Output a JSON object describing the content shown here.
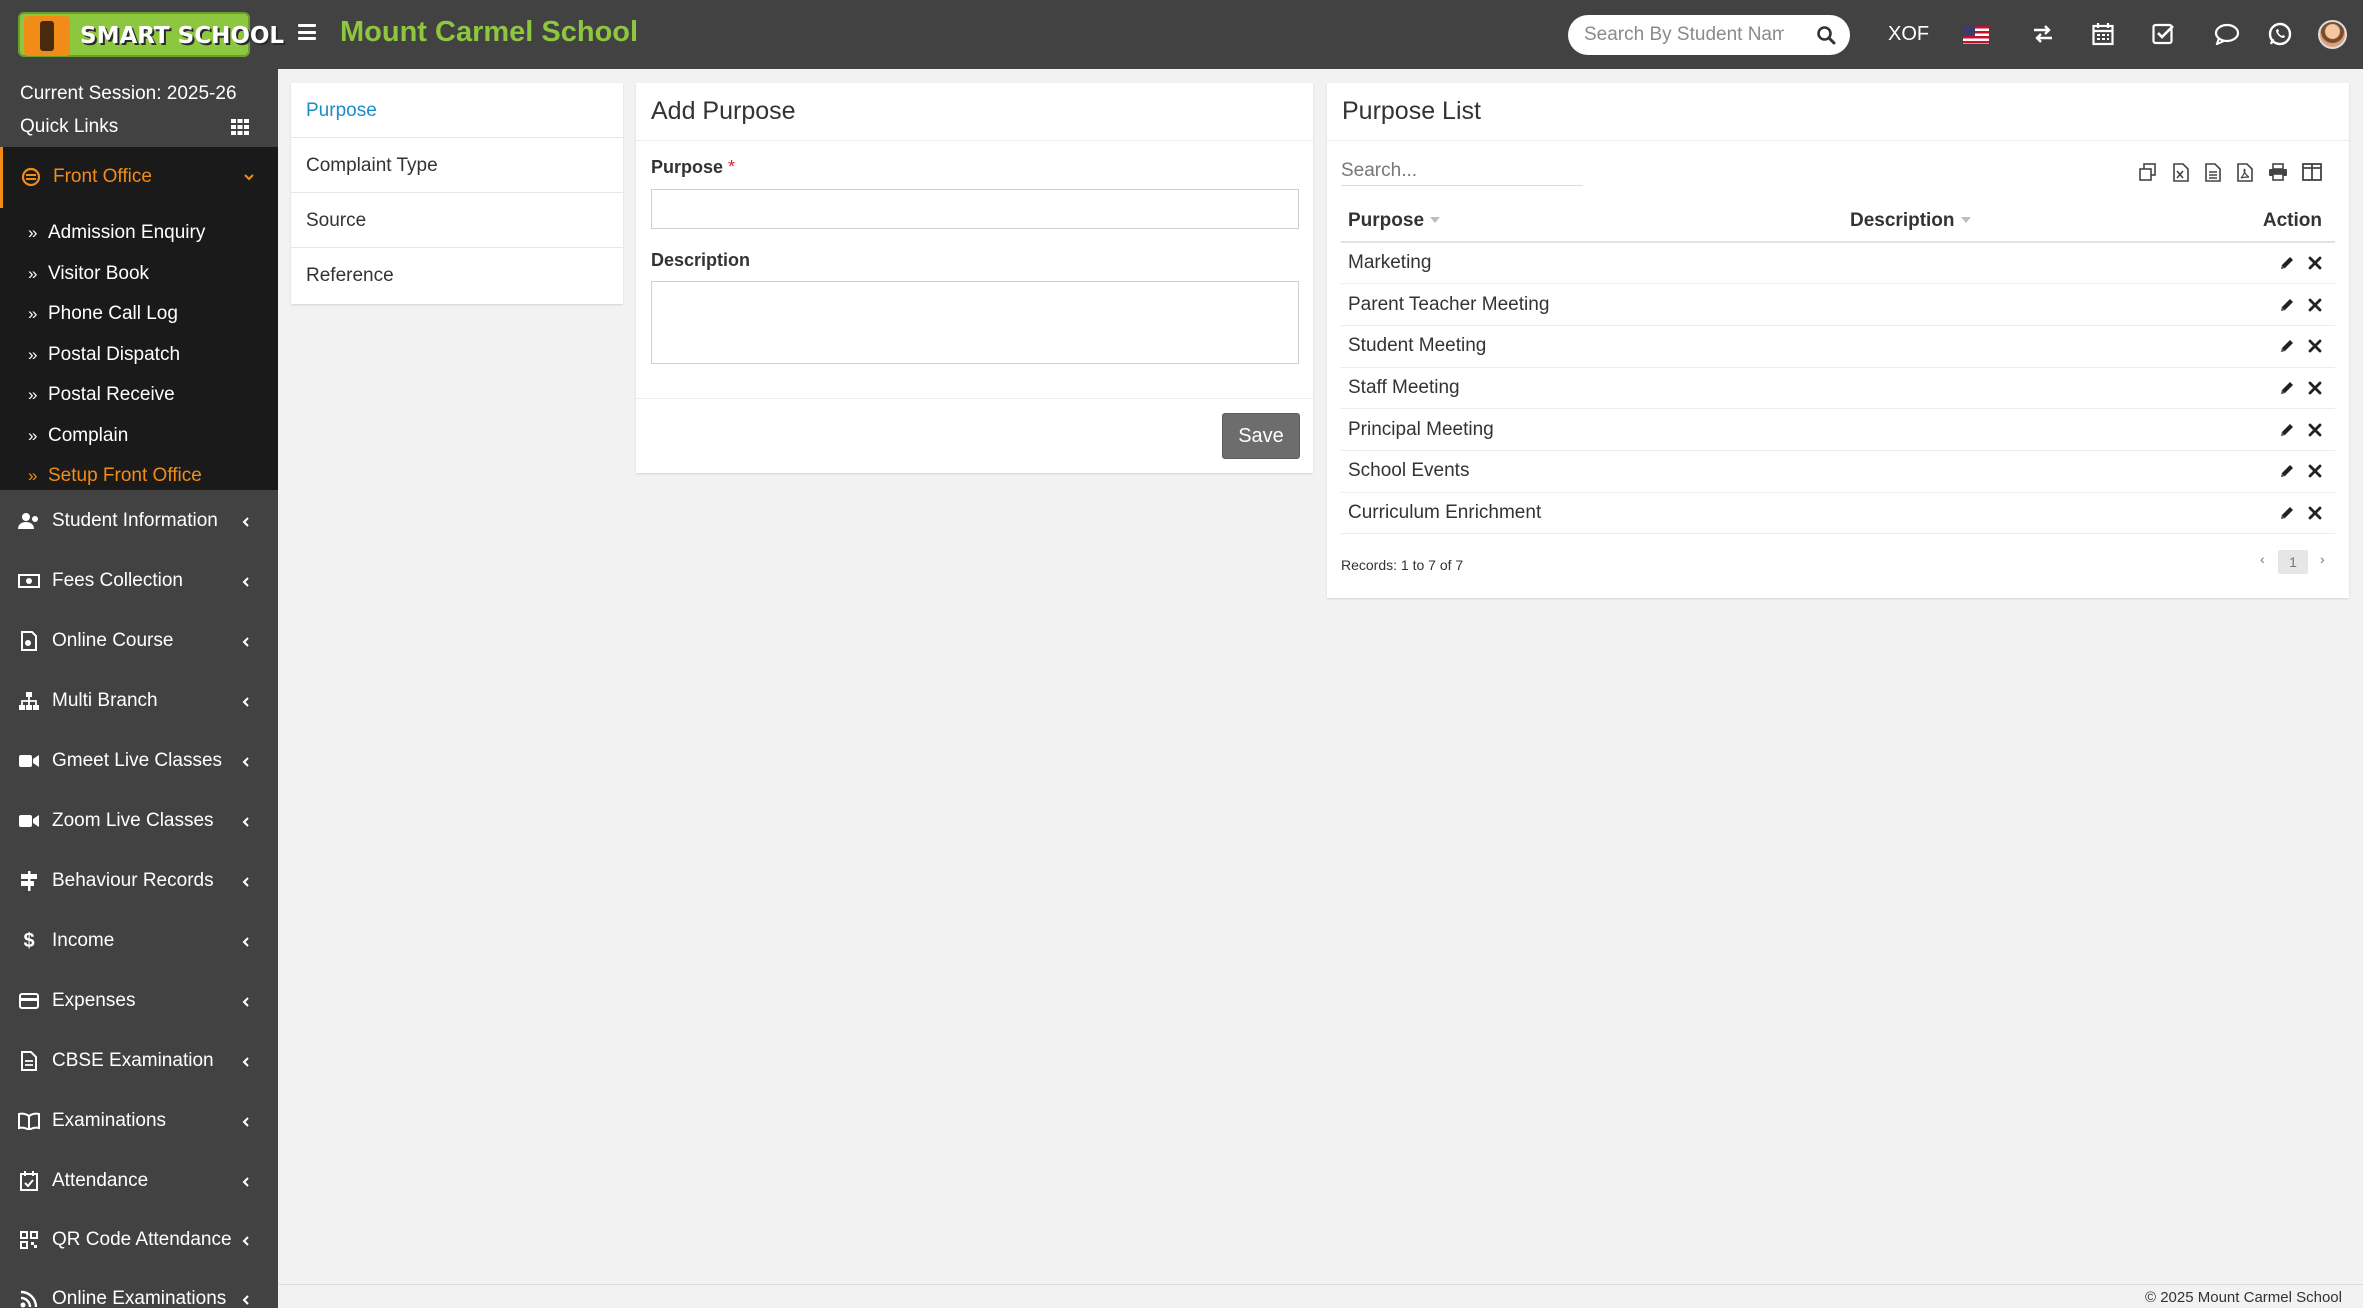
{
  "header": {
    "logo_text": "SMART SCHOOL",
    "school_name": "Mount Carmel School",
    "search_placeholder": "Search By Student Name",
    "currency": "XOF",
    "icons": [
      "menu-icon",
      "search-icon",
      "us-flag-icon",
      "exchange-icon",
      "calendar-icon",
      "task-check-icon",
      "chat-icon",
      "whatsapp-icon",
      "user-avatar"
    ]
  },
  "sidebar": {
    "session_label": "Current Session: 2025-26",
    "quick_links_label": "Quick Links",
    "active_section": {
      "label": "Front Office",
      "items": [
        {
          "label": "Admission Enquiry"
        },
        {
          "label": "Visitor Book"
        },
        {
          "label": "Phone Call Log"
        },
        {
          "label": "Postal Dispatch"
        },
        {
          "label": "Postal Receive"
        },
        {
          "label": "Complain"
        },
        {
          "label": "Setup Front Office",
          "active": true
        }
      ]
    },
    "items": [
      {
        "label": "Student Information",
        "icon": "user-group-icon"
      },
      {
        "label": "Fees Collection",
        "icon": "money-icon"
      },
      {
        "label": "Online Course",
        "icon": "course-icon"
      },
      {
        "label": "Multi Branch",
        "icon": "sitemap-icon"
      },
      {
        "label": "Gmeet Live Classes",
        "icon": "video-icon"
      },
      {
        "label": "Zoom Live Classes",
        "icon": "video-icon"
      },
      {
        "label": "Behaviour Records",
        "icon": "signpost-icon"
      },
      {
        "label": "Income",
        "icon": "dollar-icon"
      },
      {
        "label": "Expenses",
        "icon": "credit-card-icon"
      },
      {
        "label": "CBSE Examination",
        "icon": "document-icon"
      },
      {
        "label": "Examinations",
        "icon": "book-open-icon"
      },
      {
        "label": "Attendance",
        "icon": "calendar-check-icon"
      },
      {
        "label": "QR Code Attendance",
        "icon": "qrcode-icon"
      },
      {
        "label": "Online Examinations",
        "icon": "rss-icon"
      }
    ]
  },
  "setup_nav": {
    "items": [
      {
        "label": "Purpose",
        "active": true
      },
      {
        "label": "Complaint Type"
      },
      {
        "label": "Source"
      },
      {
        "label": "Reference"
      }
    ]
  },
  "add_purpose": {
    "title": "Add Purpose",
    "purpose_label": "Purpose",
    "required_mark": "*",
    "purpose_value": "",
    "description_label": "Description",
    "description_value": "",
    "save_label": "Save"
  },
  "purpose_list": {
    "title": "Purpose List",
    "search_placeholder": "Search...",
    "toolbar_icons": [
      "copy-icon",
      "excel-icon",
      "csv-icon",
      "pdf-icon",
      "print-icon",
      "columns-icon"
    ],
    "columns": [
      "Purpose",
      "Description",
      "Action"
    ],
    "rows": [
      {
        "purpose": "Marketing",
        "description": ""
      },
      {
        "purpose": "Parent Teacher Meeting",
        "description": ""
      },
      {
        "purpose": "Student Meeting",
        "description": ""
      },
      {
        "purpose": "Staff Meeting",
        "description": ""
      },
      {
        "purpose": "Principal Meeting",
        "description": ""
      },
      {
        "purpose": "School Events",
        "description": ""
      },
      {
        "purpose": "Curriculum Enrichment",
        "description": ""
      }
    ],
    "records_text": "Records: 1 to 7 of 7",
    "current_page": "1",
    "prev_label": "‹",
    "next_label": "›"
  },
  "footer": {
    "copyright": "© 2025 Mount Carmel School"
  },
  "colors": {
    "header_bg": "#424242",
    "brand_green": "#8dc63f",
    "accent_orange": "#f28c18",
    "link_blue": "#1a8cc7",
    "button_gray": "#6d6d6d"
  }
}
